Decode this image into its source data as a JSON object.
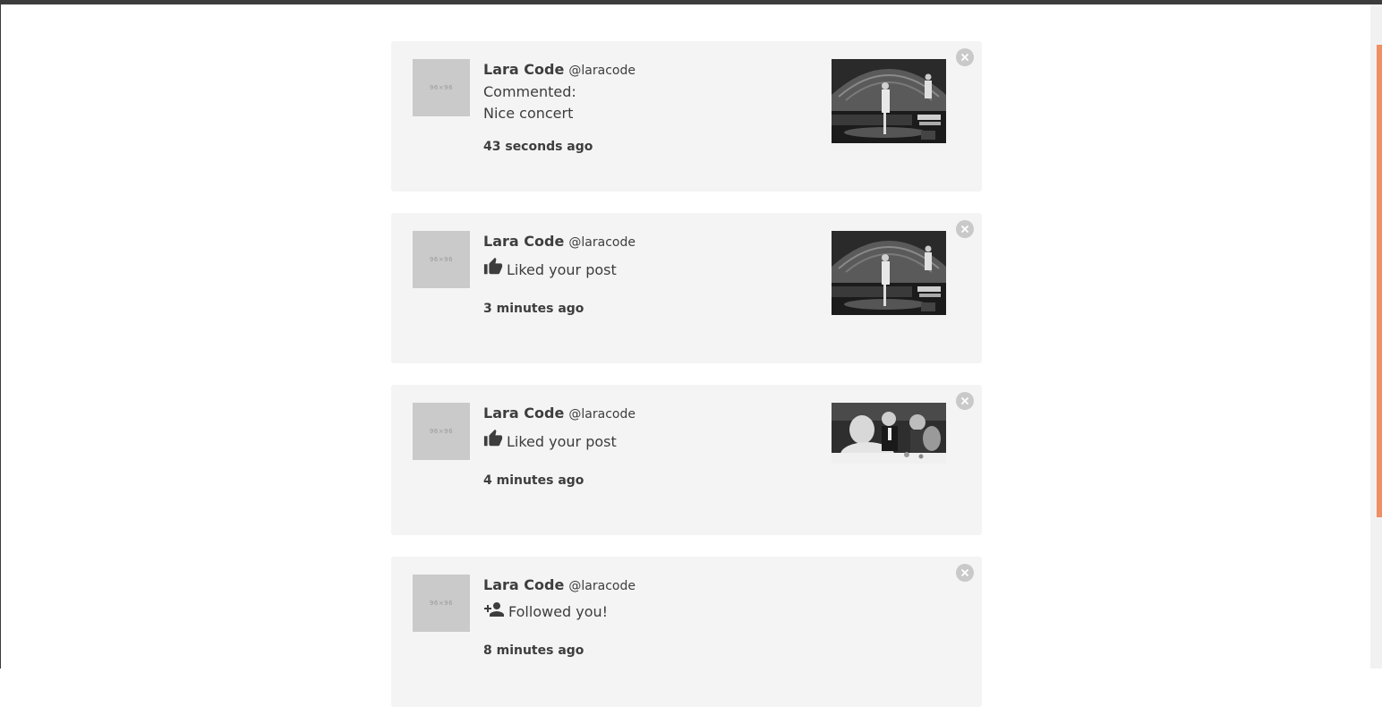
{
  "notifications": [
    {
      "avatar_placeholder": "96×96",
      "user_name": "Lara Code",
      "user_handle": "@laracode",
      "action_text": "Commented:",
      "comment_text": "Nice concert",
      "action_icon": "",
      "time": "43 seconds ago",
      "thumbnail": "concert-stage-photo"
    },
    {
      "avatar_placeholder": "96×96",
      "user_name": "Lara Code",
      "user_handle": "@laracode",
      "action_text": "Liked your post",
      "action_icon": "thumbs-up-icon",
      "time": "3 minutes ago",
      "thumbnail": "concert-stage-photo"
    },
    {
      "avatar_placeholder": "96×96",
      "user_name": "Lara Code",
      "user_handle": "@laracode",
      "action_text": "Liked your post",
      "action_icon": "thumbs-up-icon",
      "time": "4 minutes ago",
      "thumbnail": "party-table-photo"
    },
    {
      "avatar_placeholder": "96×96",
      "user_name": "Lara Code",
      "user_handle": "@laracode",
      "action_text": "Followed you!",
      "action_icon": "person-add-icon",
      "time": "8 minutes ago",
      "thumbnail": ""
    }
  ],
  "colors": {
    "card_bg": "#f4f4f4",
    "text": "#3d3d3d",
    "avatar_bg": "#cacaca",
    "close_bg": "#c9c9c9",
    "scroll_thumb": "#ef8f65"
  }
}
